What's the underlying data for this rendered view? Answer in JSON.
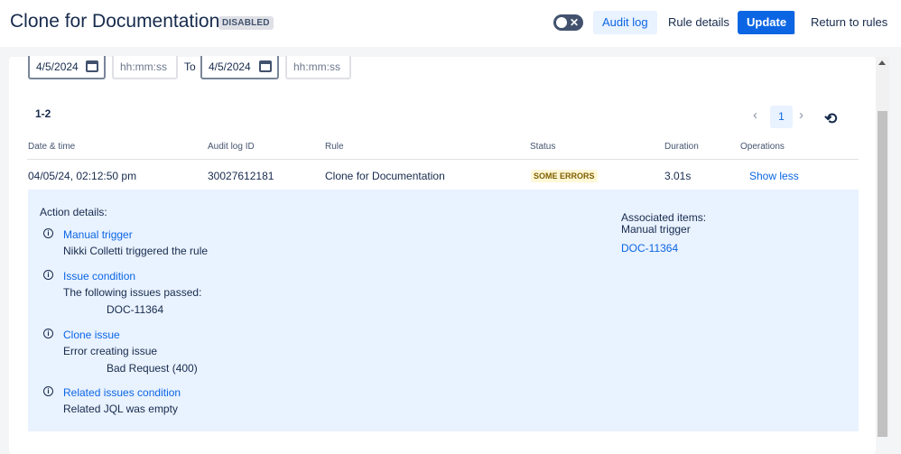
{
  "header": {
    "title": "Clone for Documentation",
    "status_lozenge": "DISABLED",
    "buttons": {
      "audit_log": "Audit log",
      "rule_details": "Rule details",
      "update": "Update",
      "return": "Return to rules"
    },
    "toggle_state": "off"
  },
  "filters": {
    "from_date": "4/5/2024",
    "from_time_placeholder": "hh:mm:ss",
    "to_label": "To",
    "to_date": "4/5/2024",
    "to_time_placeholder": "hh:mm:ss"
  },
  "results": {
    "count": "1-2",
    "current_page": "1"
  },
  "table": {
    "headers": [
      "Date & time",
      "Audit log ID",
      "Rule",
      "Status",
      "Duration",
      "Operations"
    ],
    "row": {
      "date": "04/05/24, 02:12:50 pm",
      "id": "30027612181",
      "rule": "Clone for Documentation",
      "status": "SOME ERRORS",
      "duration": "3.01s",
      "operation": "Show less"
    }
  },
  "details": {
    "title": "Action details:",
    "actions": [
      {
        "title": "Manual trigger",
        "lines": [
          "Nikki Colletti triggered the rule"
        ]
      },
      {
        "title": "Issue condition",
        "lines": [
          "The following issues passed:",
          "DOC-11364"
        ]
      },
      {
        "title": "Clone issue",
        "lines": [
          "Error creating issue",
          "Bad Request (400)"
        ]
      },
      {
        "title": "Related issues condition",
        "lines": [
          "Related JQL was empty"
        ]
      }
    ],
    "associated": {
      "title": "Associated items:",
      "subtitle": "Manual trigger",
      "link": "DOC-11364"
    }
  },
  "colors": {
    "accent": "#0c66e4",
    "details_bg": "#e9f2ff",
    "warning_lozenge_bg": "#fff7d6",
    "warning_lozenge_text": "#7f5f01"
  },
  "icons": [
    "calendar-icon",
    "chevron-left-icon",
    "chevron-right-icon",
    "refresh-icon",
    "info-icon",
    "close-icon"
  ]
}
